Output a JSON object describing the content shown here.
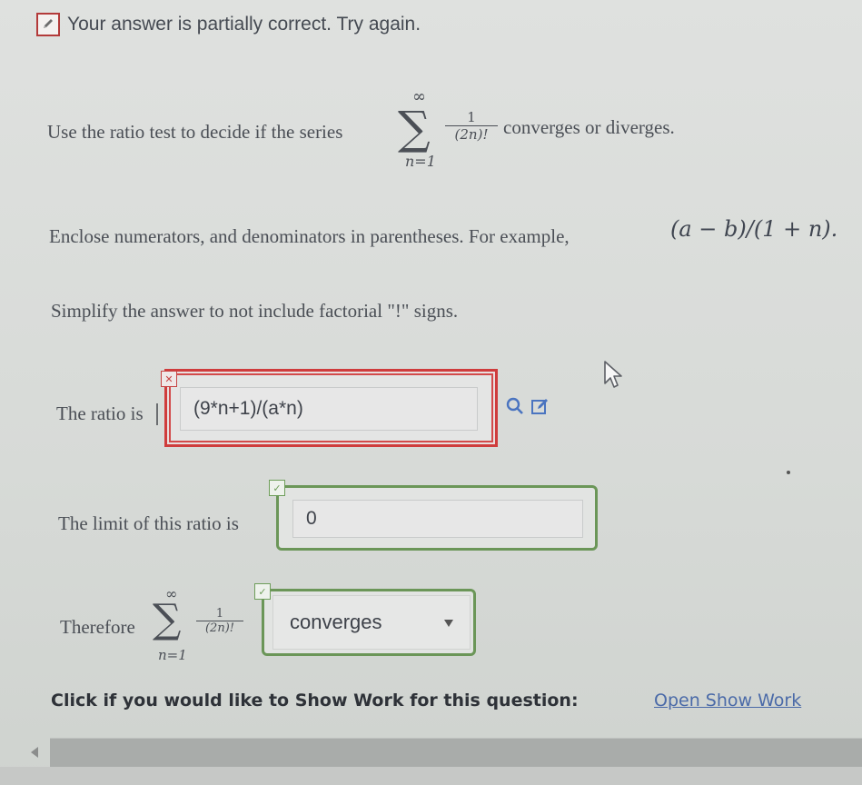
{
  "status": {
    "text": "Your answer is partially correct.  Try again.",
    "icon": "edit-check-icon"
  },
  "question": {
    "intro_prefix": "Use the ratio test to decide if the series",
    "intro_suffix": "converges or diverges.",
    "sum_upper": "∞",
    "sum_lower": "n=1",
    "term_numerator": "1",
    "term_denominator": "(2n)!",
    "instruction_parentheses": "Enclose numerators, and denominators in parentheses. For example,",
    "example_expr": "(a − b)/(1 + n).",
    "instruction_factorial": "Simplify the answer to not include factorial \"!\" signs."
  },
  "ratio": {
    "label": "The ratio is",
    "value": "(9*n+1)/(a*n)",
    "flag": "✕"
  },
  "limit": {
    "label": "The limit of this ratio is",
    "value": "0",
    "flag": "✓"
  },
  "therefore": {
    "label": "Therefore",
    "sum_upper": "∞",
    "sum_lower": "n=1",
    "term_numerator": "1",
    "term_denominator": "(2n)!",
    "selected": "converges",
    "flag": "✓"
  },
  "show_work": {
    "prompt": "Click if you would like to Show Work for this question:",
    "link": "Open Show Work"
  },
  "colors": {
    "incorrect": "#cf3c3c",
    "correct": "#6b9658",
    "link": "#4a6aa8"
  }
}
